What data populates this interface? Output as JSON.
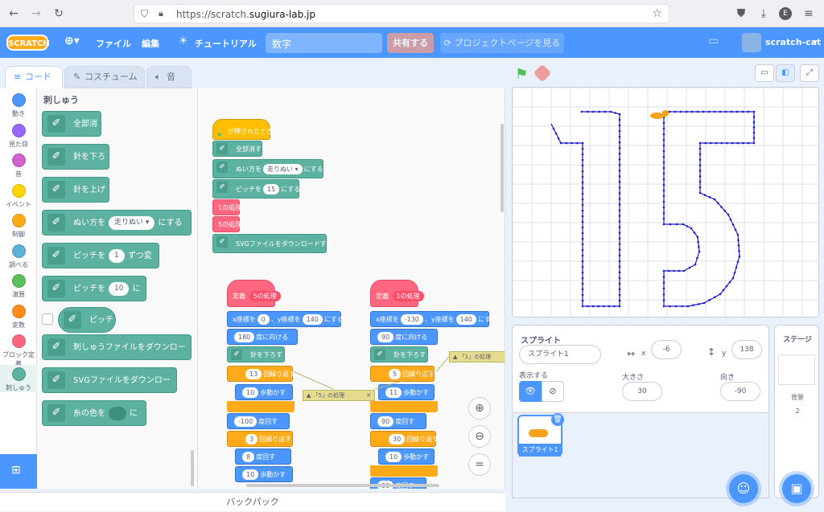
{
  "browser": {
    "url_prefix": "https://scratch.",
    "url_host": "sugiura-lab.jp",
    "avatar_letter": "E"
  },
  "menu": {
    "logo": "SCRATCH",
    "file": "ファイル",
    "edit": "編集",
    "tutorial": "チュートリアル",
    "project_title": "数字",
    "share": "共有する",
    "project_page": "プロジェクトページを見る",
    "username": "scratch-cat"
  },
  "tabs": {
    "code": "コード",
    "costumes": "コスチューム",
    "sounds": "音"
  },
  "categories": [
    {
      "label": "動き",
      "color": "#4c97ff"
    },
    {
      "label": "見た目",
      "color": "#9966ff"
    },
    {
      "label": "音",
      "color": "#cf63cf"
    },
    {
      "label": "イベント",
      "color": "#ffd500"
    },
    {
      "label": "制御",
      "color": "#ffab19"
    },
    {
      "label": "調べる",
      "color": "#5cb1d6"
    },
    {
      "label": "演算",
      "color": "#59c059"
    },
    {
      "label": "変数",
      "color": "#ff8c1a"
    },
    {
      "label": "ブロック定義",
      "color": "#ff6680"
    },
    {
      "label": "刺しゅう",
      "color": "#5cb1a0"
    }
  ],
  "palette": {
    "heading": "刺しゅう",
    "clear": "全部消す",
    "pen_down": "針を下ろす",
    "pen_up": "針を上げる",
    "stitch_pre": "ぬい方を",
    "stitch_val": "走りぬい",
    "stitch_post": "にする",
    "pitch_change_pre": "ピッチを",
    "pitch_change_val": "1",
    "pitch_change_post": "ずつ変える",
    "pitch_set_pre": "ピッチを",
    "pitch_set_val": "10",
    "pitch_set_post": "にする",
    "pitch_reporter": "ピッチ",
    "download_embroidery": "刺しゅうファイルをダウンロードする",
    "download_svg": "SVGファイルをダウンロードする",
    "color_pre": "糸の色を",
    "color_post": "にする"
  },
  "script_main": {
    "hat": "が押されたとき",
    "clear": "全部消す",
    "stitch_pre": "ぬい方を",
    "stitch_val": "走りぬい",
    "stitch_post": "にする",
    "pitch_pre": "ピッチを",
    "pitch_val": "15",
    "pitch_post": "にする",
    "call1": "1の処理",
    "call5": "5の処理",
    "download_svg": "SVGファイルをダウンロードする"
  },
  "script_5": {
    "define": "定義",
    "name": "5の処理",
    "goto_x_pre": "x座標を",
    "goto_x_val": "0",
    "goto_y_pre": "、y座標を",
    "goto_y_val": "140",
    "goto_post": "にする",
    "dir_val": "180",
    "dir_post": "度に向ける",
    "pen_down": "針を下ろす",
    "repeat1_val": "13",
    "repeat_post": "回繰り返す",
    "move1_val": "10",
    "move_post": "歩動かす",
    "turn1_val": "-100",
    "turn_post": "度回す",
    "repeat2_val": "3",
    "turn2_val": "8",
    "move2_val": "10"
  },
  "script_1": {
    "define": "定義",
    "name": "1の処理",
    "goto_x_pre": "x座標を",
    "goto_x_val": "-130",
    "goto_y_pre": "、y座標を",
    "goto_y_val": "140",
    "goto_post": "にする",
    "dir_val": "90",
    "dir_post": "度に向ける",
    "pen_down": "針を下ろす",
    "repeat1_val": "5",
    "repeat_post": "回繰り返す",
    "move1_val": "11",
    "move_post": "歩動かす",
    "turn1_val": "90",
    "turn_post": "度回す",
    "repeat2_val": "30",
    "move2_val": "10",
    "turn2_val": "90"
  },
  "comments": {
    "c5": "「5」の処理",
    "c1": "「1」の処理"
  },
  "backpack": "バックパック",
  "sprite_panel": {
    "title": "スプライト",
    "name": "スプライト1",
    "x_label": "x",
    "x_value": "-6",
    "y_label": "y",
    "y_value": "138",
    "show_label": "表示する",
    "size_label": "大きさ",
    "size_value": "30",
    "direction_label": "向き",
    "direction_value": "-90",
    "thumb_label": "スプライト1"
  },
  "stage_panel": {
    "title": "ステージ",
    "backdrop_label": "背景",
    "backdrop_count": "2"
  },
  "colors": {
    "accent": "#4c97ff",
    "stitch": "#1a1acc",
    "embroidery": "#5cb1a0"
  }
}
